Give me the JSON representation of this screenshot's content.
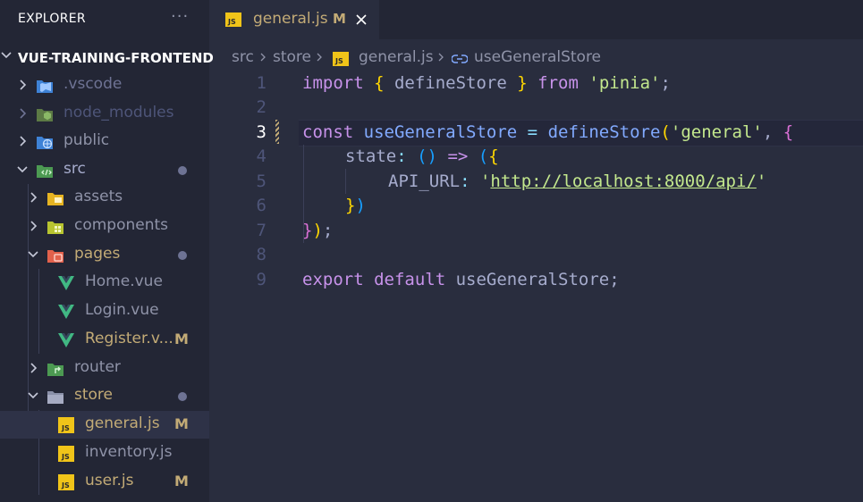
{
  "sidebar": {
    "title": "EXPLORER",
    "more_label": "···",
    "root_label": "VUE-TRAINING-FRONTEND",
    "items": [
      {
        "label": ".vscode",
        "color": "#6e7394",
        "icon": "vscode-folder-icon"
      },
      {
        "label": "node_modules",
        "color": "#4e5579",
        "icon": "node-folder-icon"
      },
      {
        "label": "public",
        "color": "#8f93a8",
        "icon": "public-folder-icon"
      },
      {
        "label": "src",
        "color": "#a6accd",
        "icon": "src-folder-icon"
      },
      {
        "label": "assets",
        "color": "#8f93a8",
        "icon": "assets-folder-icon"
      },
      {
        "label": "components",
        "color": "#8f93a8",
        "icon": "components-folder-icon"
      },
      {
        "label": "pages",
        "color": "#c3ab76",
        "icon": "pages-folder-icon"
      },
      {
        "label": "Home.vue",
        "color": "#8f93a8",
        "icon": "vue-icon"
      },
      {
        "label": "Login.vue",
        "color": "#8f93a8",
        "icon": "vue-icon"
      },
      {
        "label": "Register.v...",
        "color": "#c3ab76",
        "icon": "vue-icon",
        "badge": "M"
      },
      {
        "label": "router",
        "color": "#8f93a8",
        "icon": "router-folder-icon"
      },
      {
        "label": "store",
        "color": "#c3ab76",
        "icon": "store-folder-icon"
      },
      {
        "label": "general.js",
        "color": "#c3ab76",
        "icon": "js-icon",
        "badge": "M"
      },
      {
        "label": "inventory.js",
        "color": "#8f93a8",
        "icon": "js-icon"
      },
      {
        "label": "user.js",
        "color": "#c3ab76",
        "icon": "js-icon",
        "badge": "M"
      }
    ]
  },
  "tab": {
    "icon_text": "JS",
    "label": "general.js",
    "badge": "M"
  },
  "breadcrumb": {
    "src": "src",
    "store": "store",
    "file": "general.js",
    "symbol": "useGeneralStore"
  },
  "editor": {
    "line_numbers": [
      "1",
      "2",
      "3",
      "4",
      "5",
      "6",
      "7",
      "8",
      "9"
    ],
    "line1": {
      "t1": "import",
      "t2": " ",
      "t3": "{",
      "t4": " defineStore ",
      "t5": "}",
      "t6": " ",
      "t7": "from",
      "t8": " ",
      "t9": "'pinia'",
      "t10": ";"
    },
    "line3": {
      "t1": "const",
      "t2": " useGeneralStore ",
      "t3": "=",
      "t4": " ",
      "t5": "defineStore",
      "t6": "(",
      "t7": "'general'",
      "t8": ", ",
      "t9": "{"
    },
    "line4": {
      "t1": "state",
      "t2": ": ",
      "t3": "()",
      "t4": " ",
      "t5": "=>",
      "t6": " ",
      "t7": "(",
      "t8": "{"
    },
    "line5": {
      "t1": "API_URL",
      "t2": ": ",
      "t3": "'",
      "t4": "http://localhost:8000/api/",
      "t5": "'"
    },
    "line6": {
      "t1": "}",
      "t2": ")"
    },
    "line7": {
      "t1": "}",
      "t2": ")",
      "t3": ";"
    },
    "line9": {
      "t1": "export",
      "t2": " ",
      "t3": "default",
      "t4": " useGeneralStore;"
    }
  }
}
